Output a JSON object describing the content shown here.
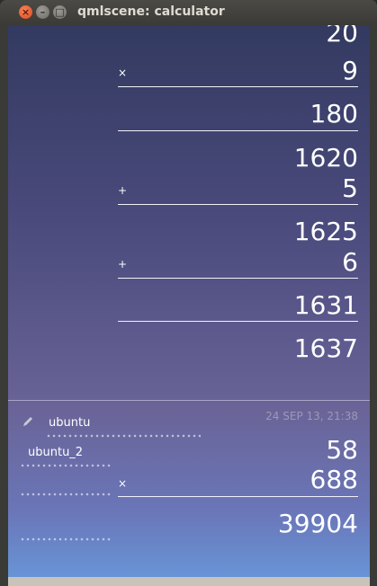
{
  "window": {
    "title": "qmlscene: calculator"
  },
  "calc": {
    "top_partial": "20",
    "op1": "×",
    "v1": "9",
    "r1": "180",
    "v2": "1620",
    "op2": "+",
    "v3": "5",
    "r2": "1625",
    "op3": "+",
    "v4": "6",
    "r3": "1631",
    "r4": "1637"
  },
  "history": {
    "label1": "ubuntu",
    "date": "24 SEP 13, 21:38",
    "label2": "ubuntu_2",
    "v1": "58",
    "op": "×",
    "v2": "688",
    "result": "39904"
  },
  "icons": {
    "edit": "pencil-icon",
    "close": "close-icon",
    "minimize": "minimize-icon",
    "maximize": "maximize-icon"
  },
  "colors": {
    "titlebar": "#3b3a36",
    "close": "#e0461f",
    "gradient_top": "#333a60",
    "gradient_bottom": "#6894d6"
  }
}
